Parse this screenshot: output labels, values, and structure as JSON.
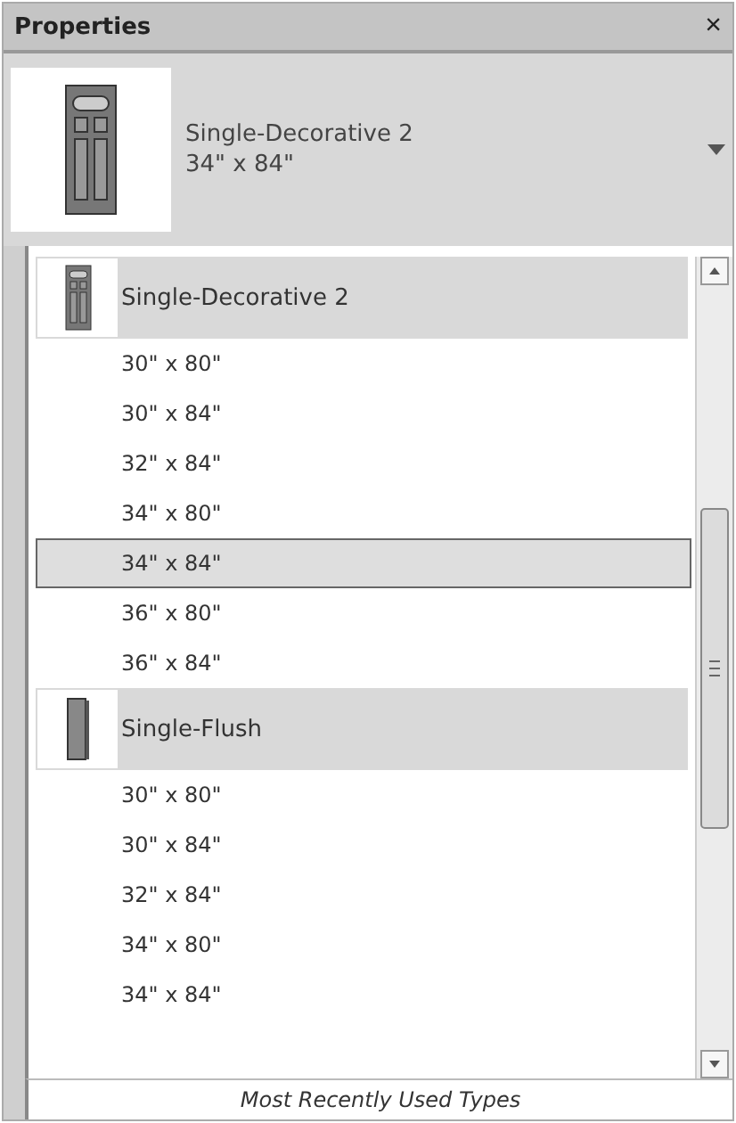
{
  "panel": {
    "title": "Properties",
    "close": "×"
  },
  "selector": {
    "name": "Single-Decorative 2",
    "size": "34\" x 84\""
  },
  "groups": [
    {
      "name": "Single-Decorative 2",
      "kind": "decorative",
      "items": [
        {
          "label": "30\" x 80\"",
          "selected": false
        },
        {
          "label": "30\" x 84\"",
          "selected": false
        },
        {
          "label": "32\" x 84\"",
          "selected": false
        },
        {
          "label": "34\" x 80\"",
          "selected": false
        },
        {
          "label": "34\" x 84\"",
          "selected": true
        },
        {
          "label": "36\" x 80\"",
          "selected": false
        },
        {
          "label": "36\" x 84\"",
          "selected": false
        }
      ]
    },
    {
      "name": "Single-Flush",
      "kind": "flush",
      "items": [
        {
          "label": "30\" x 80\"",
          "selected": false
        },
        {
          "label": "30\" x 84\"",
          "selected": false
        },
        {
          "label": "32\" x 84\"",
          "selected": false
        },
        {
          "label": "34\" x 80\"",
          "selected": false
        },
        {
          "label": "34\" x 84\"",
          "selected": false
        }
      ]
    }
  ],
  "footer": "Most Recently Used Types"
}
